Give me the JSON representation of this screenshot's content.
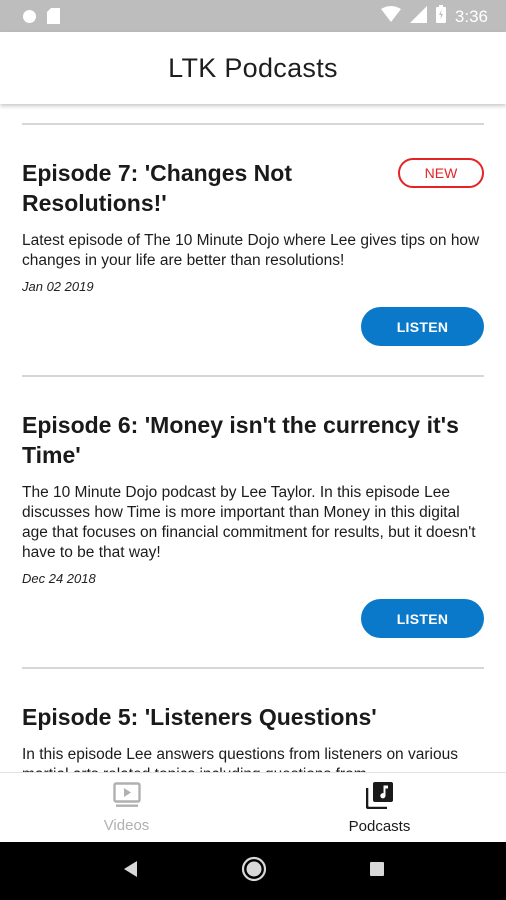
{
  "status_bar": {
    "time": "3:36",
    "icons": [
      "circle-notification-icon",
      "sd-card-icon",
      "wifi-icon",
      "signal-icon",
      "battery-icon"
    ]
  },
  "app_bar": {
    "title": "LTK Podcasts"
  },
  "episodes": [
    {
      "title": "Episode 7:  'Changes Not Resolutions!'",
      "badge": "NEW",
      "description": "Latest episode of The 10 Minute Dojo where Lee gives tips on how changes in your life are better than resolutions!",
      "date": "Jan 02 2019",
      "button": "LISTEN"
    },
    {
      "title": "Episode 6:  'Money isn't the currency it's Time'",
      "description": "The 10 Minute Dojo podcast by Lee Taylor. In this episode Lee discusses how Time is more important than Money in this digital age that focuses on financial commitment for results, but it doesn't have to be that way!",
      "date": "Dec 24 2018",
      "button": "LISTEN"
    },
    {
      "title": "Episode 5:  'Listeners Questions'",
      "description": "In this episode Lee answers questions from listeners on various martial arts related topics including questions from"
    }
  ],
  "bottom_nav": {
    "items": [
      {
        "label": "Videos",
        "icon": "video-play-icon",
        "active": false
      },
      {
        "label": "Podcasts",
        "icon": "music-library-icon",
        "active": true
      }
    ]
  },
  "system_nav": {
    "icons": [
      "back-icon",
      "home-icon",
      "recents-icon"
    ]
  },
  "colors": {
    "accent": "#0a79c9",
    "badge": "#e52323",
    "status_bar": "#bdbdbd"
  }
}
